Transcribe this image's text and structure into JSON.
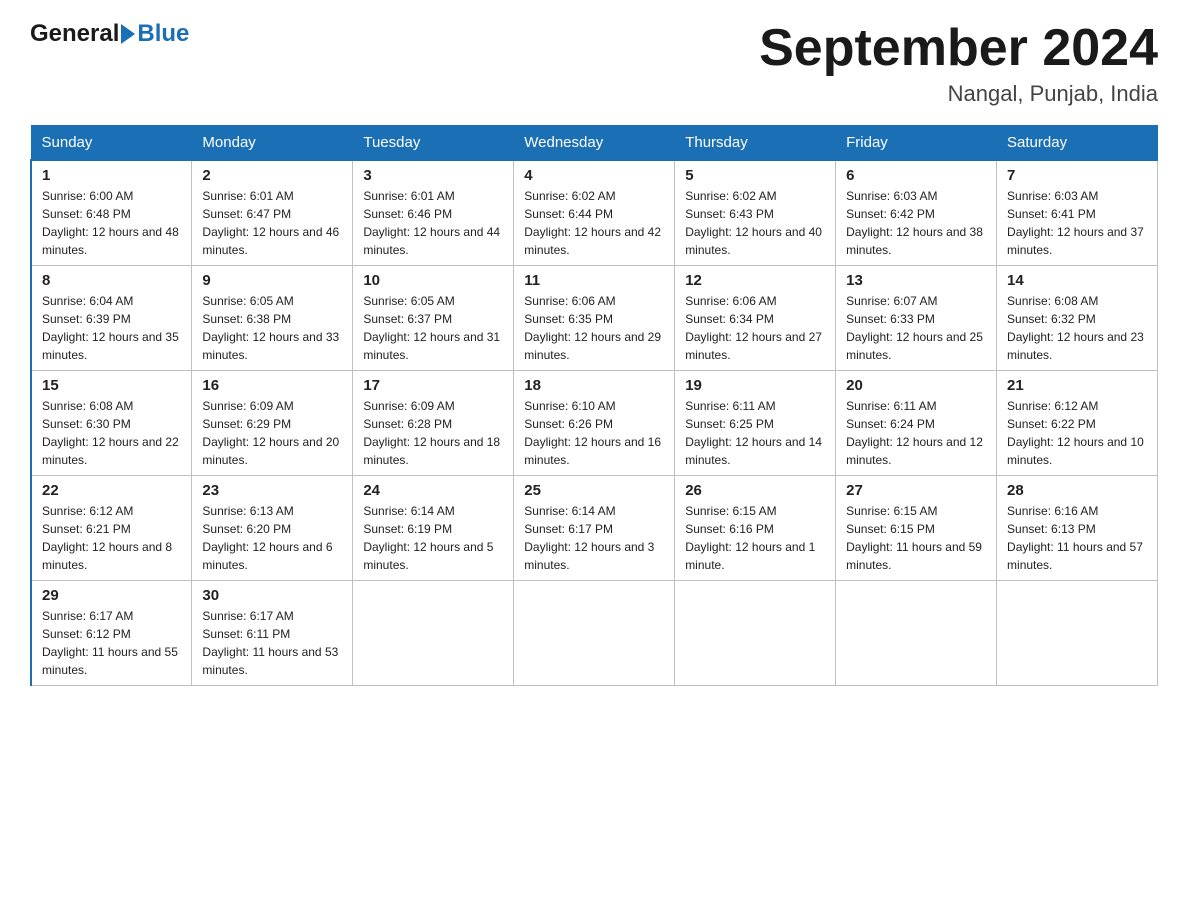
{
  "logo": {
    "general": "General",
    "blue": "Blue"
  },
  "calendar": {
    "title": "September 2024",
    "subtitle": "Nangal, Punjab, India"
  },
  "days_of_week": [
    "Sunday",
    "Monday",
    "Tuesday",
    "Wednesday",
    "Thursday",
    "Friday",
    "Saturday"
  ],
  "weeks": [
    [
      {
        "day": "1",
        "sunrise": "6:00 AM",
        "sunset": "6:48 PM",
        "daylight": "12 hours and 48 minutes."
      },
      {
        "day": "2",
        "sunrise": "6:01 AM",
        "sunset": "6:47 PM",
        "daylight": "12 hours and 46 minutes."
      },
      {
        "day": "3",
        "sunrise": "6:01 AM",
        "sunset": "6:46 PM",
        "daylight": "12 hours and 44 minutes."
      },
      {
        "day": "4",
        "sunrise": "6:02 AM",
        "sunset": "6:44 PM",
        "daylight": "12 hours and 42 minutes."
      },
      {
        "day": "5",
        "sunrise": "6:02 AM",
        "sunset": "6:43 PM",
        "daylight": "12 hours and 40 minutes."
      },
      {
        "day": "6",
        "sunrise": "6:03 AM",
        "sunset": "6:42 PM",
        "daylight": "12 hours and 38 minutes."
      },
      {
        "day": "7",
        "sunrise": "6:03 AM",
        "sunset": "6:41 PM",
        "daylight": "12 hours and 37 minutes."
      }
    ],
    [
      {
        "day": "8",
        "sunrise": "6:04 AM",
        "sunset": "6:39 PM",
        "daylight": "12 hours and 35 minutes."
      },
      {
        "day": "9",
        "sunrise": "6:05 AM",
        "sunset": "6:38 PM",
        "daylight": "12 hours and 33 minutes."
      },
      {
        "day": "10",
        "sunrise": "6:05 AM",
        "sunset": "6:37 PM",
        "daylight": "12 hours and 31 minutes."
      },
      {
        "day": "11",
        "sunrise": "6:06 AM",
        "sunset": "6:35 PM",
        "daylight": "12 hours and 29 minutes."
      },
      {
        "day": "12",
        "sunrise": "6:06 AM",
        "sunset": "6:34 PM",
        "daylight": "12 hours and 27 minutes."
      },
      {
        "day": "13",
        "sunrise": "6:07 AM",
        "sunset": "6:33 PM",
        "daylight": "12 hours and 25 minutes."
      },
      {
        "day": "14",
        "sunrise": "6:08 AM",
        "sunset": "6:32 PM",
        "daylight": "12 hours and 23 minutes."
      }
    ],
    [
      {
        "day": "15",
        "sunrise": "6:08 AM",
        "sunset": "6:30 PM",
        "daylight": "12 hours and 22 minutes."
      },
      {
        "day": "16",
        "sunrise": "6:09 AM",
        "sunset": "6:29 PM",
        "daylight": "12 hours and 20 minutes."
      },
      {
        "day": "17",
        "sunrise": "6:09 AM",
        "sunset": "6:28 PM",
        "daylight": "12 hours and 18 minutes."
      },
      {
        "day": "18",
        "sunrise": "6:10 AM",
        "sunset": "6:26 PM",
        "daylight": "12 hours and 16 minutes."
      },
      {
        "day": "19",
        "sunrise": "6:11 AM",
        "sunset": "6:25 PM",
        "daylight": "12 hours and 14 minutes."
      },
      {
        "day": "20",
        "sunrise": "6:11 AM",
        "sunset": "6:24 PM",
        "daylight": "12 hours and 12 minutes."
      },
      {
        "day": "21",
        "sunrise": "6:12 AM",
        "sunset": "6:22 PM",
        "daylight": "12 hours and 10 minutes."
      }
    ],
    [
      {
        "day": "22",
        "sunrise": "6:12 AM",
        "sunset": "6:21 PM",
        "daylight": "12 hours and 8 minutes."
      },
      {
        "day": "23",
        "sunrise": "6:13 AM",
        "sunset": "6:20 PM",
        "daylight": "12 hours and 6 minutes."
      },
      {
        "day": "24",
        "sunrise": "6:14 AM",
        "sunset": "6:19 PM",
        "daylight": "12 hours and 5 minutes."
      },
      {
        "day": "25",
        "sunrise": "6:14 AM",
        "sunset": "6:17 PM",
        "daylight": "12 hours and 3 minutes."
      },
      {
        "day": "26",
        "sunrise": "6:15 AM",
        "sunset": "6:16 PM",
        "daylight": "12 hours and 1 minute."
      },
      {
        "day": "27",
        "sunrise": "6:15 AM",
        "sunset": "6:15 PM",
        "daylight": "11 hours and 59 minutes."
      },
      {
        "day": "28",
        "sunrise": "6:16 AM",
        "sunset": "6:13 PM",
        "daylight": "11 hours and 57 minutes."
      }
    ],
    [
      {
        "day": "29",
        "sunrise": "6:17 AM",
        "sunset": "6:12 PM",
        "daylight": "11 hours and 55 minutes."
      },
      {
        "day": "30",
        "sunrise": "6:17 AM",
        "sunset": "6:11 PM",
        "daylight": "11 hours and 53 minutes."
      },
      null,
      null,
      null,
      null,
      null
    ]
  ]
}
